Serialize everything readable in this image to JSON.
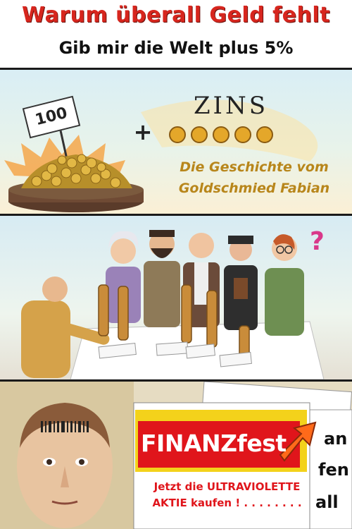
{
  "header": {
    "title": "Warum überall Geld fehlt",
    "subtitle": "Gib mir die Welt plus 5%"
  },
  "panel1": {
    "price_tag": "100",
    "plus_sign": "+",
    "zins_word": "ZINS",
    "story_line1": "Die Geschichte vom",
    "story_line2": "Goldschmied Fabian"
  },
  "panel2": {
    "question_mark": "?"
  },
  "panel3": {
    "newspaper_title": "FINANZfest",
    "ad_line1": "Jetzt die ULTRAVIOLETTE",
    "ad_line2": "AKTIE kaufen ! . . . . . . . .",
    "side_text1": "an",
    "side_text2": "fen",
    "side_text3": "all"
  },
  "colors": {
    "title_red": "#d7261e",
    "gold": "#b8861b",
    "news_red": "#e0151b",
    "news_yellow": "#f3d21b"
  }
}
